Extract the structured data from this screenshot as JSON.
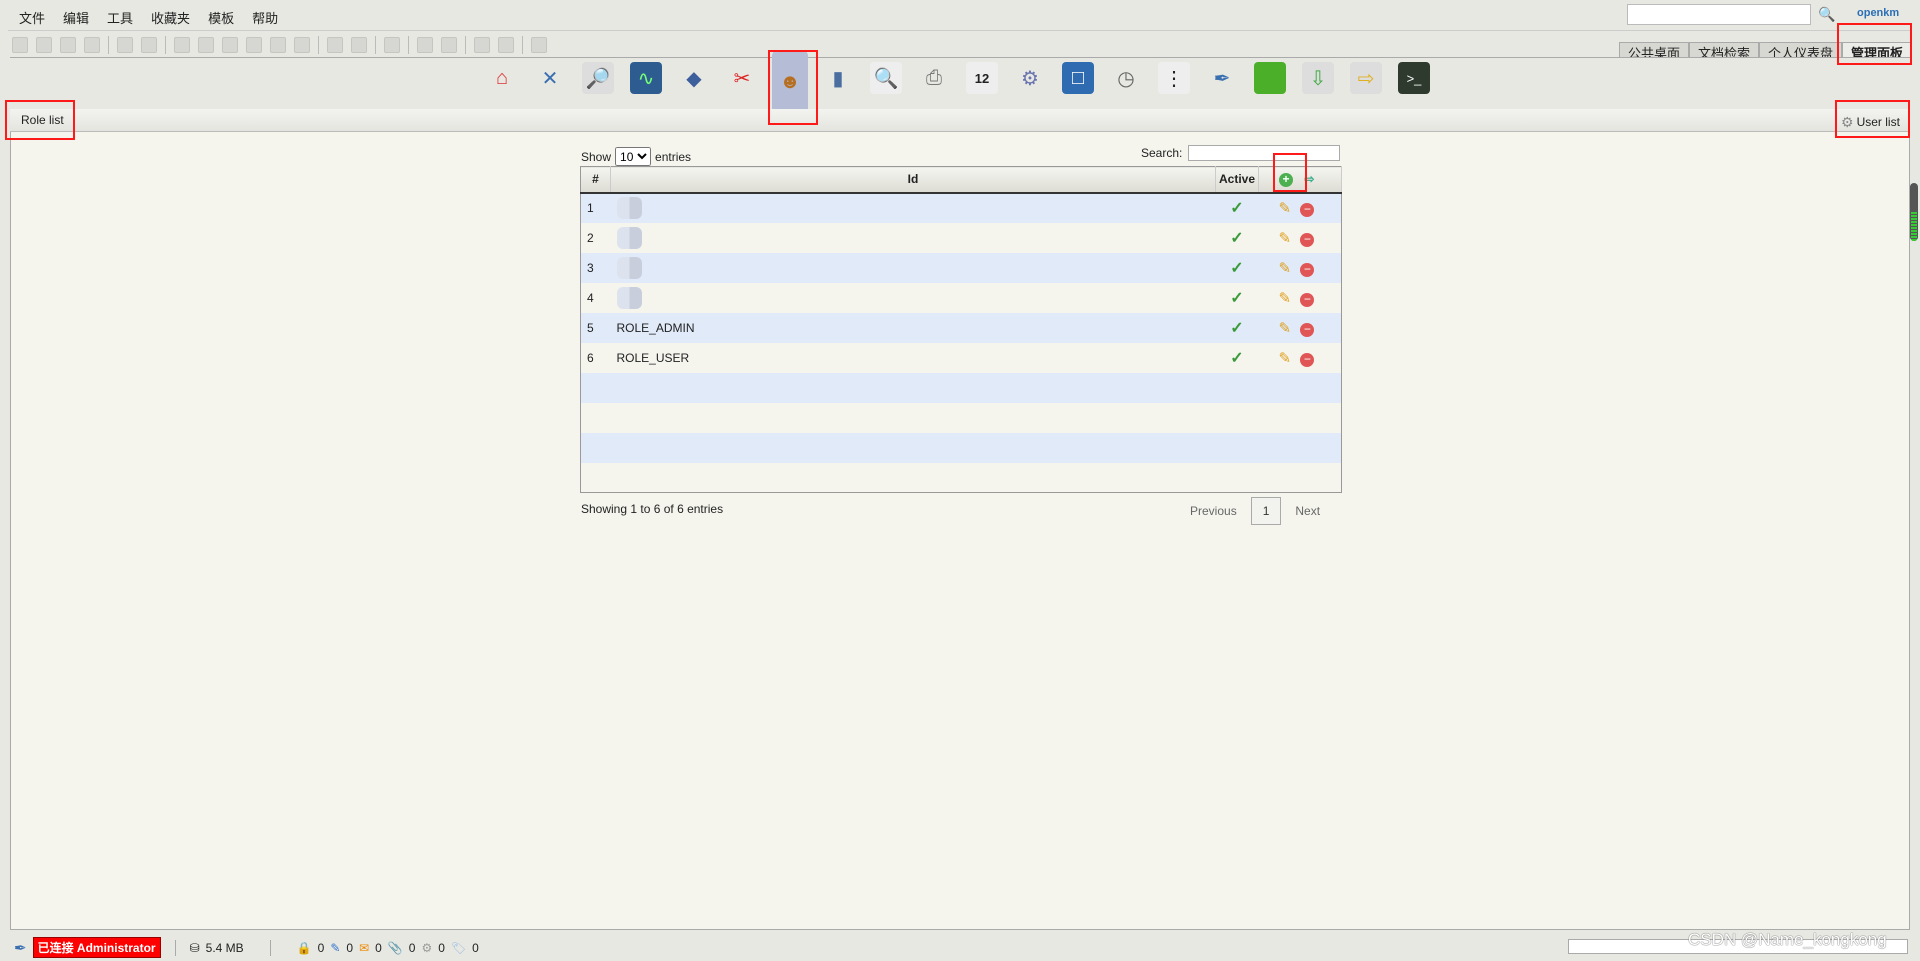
{
  "menu": [
    "文件",
    "编辑",
    "工具",
    "收藏夹",
    "模板",
    "帮助"
  ],
  "logo": "openkm",
  "tabs": [
    "公共桌面",
    "文档检索",
    "个人仪表盘",
    "管理面板"
  ],
  "admin_icons": [
    "home-icon",
    "tools-icon",
    "search-doc-icon",
    "monitor-icon",
    "diamond-icon",
    "scissors-icon",
    "users-icon",
    "profiles-icon",
    "preview-icon",
    "printer-icon",
    "calendar-icon",
    "gear-icon",
    "window-icon",
    "clock-icon",
    "list-icon",
    "pen-cup-icon",
    "flag-icon",
    "import-icon",
    "export-icon",
    "terminal-icon"
  ],
  "breadcrumb": {
    "left": "Role list",
    "right": "User list"
  },
  "table": {
    "show_label": "Show",
    "entries_label": "entries",
    "page_size": "10",
    "search_label": "Search:",
    "headers": {
      "num": "#",
      "id": "Id",
      "active": "Active"
    },
    "rows": [
      {
        "num": "1",
        "id": "",
        "active": true
      },
      {
        "num": "2",
        "id": "",
        "active": true
      },
      {
        "num": "3",
        "id": "",
        "active": true
      },
      {
        "num": "4",
        "id": "",
        "active": true
      },
      {
        "num": "5",
        "id": "ROLE_ADMIN",
        "active": true
      },
      {
        "num": "6",
        "id": "ROLE_USER",
        "active": true
      }
    ],
    "info": "Showing 1 to 6 of 6 entries",
    "previous": "Previous",
    "page": "1",
    "next": "Next"
  },
  "status": {
    "connected": "已连接 Administrator",
    "size": "5.4 MB",
    "counts": [
      "0",
      "0",
      "0",
      "0",
      "0",
      "0"
    ]
  },
  "watermark": "CSDN @Name_kongkong",
  "highlight_color": "#ff1a1a"
}
